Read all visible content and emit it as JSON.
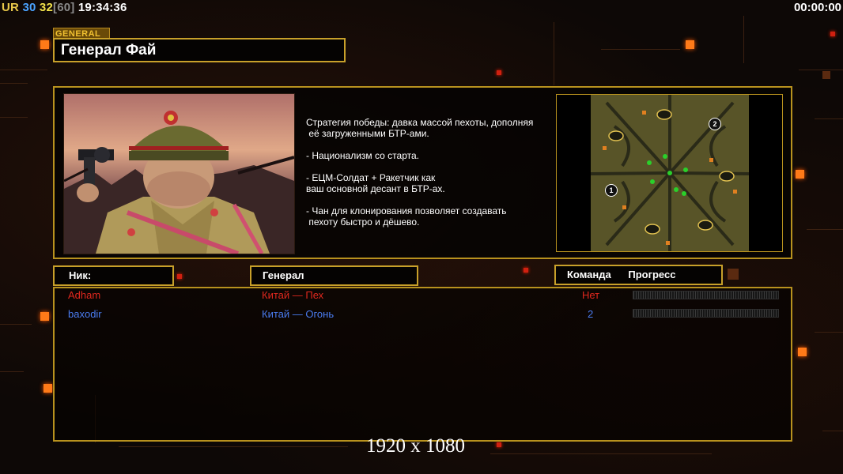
{
  "hud": {
    "ur": "UR",
    "val30": "30",
    "val32": "32",
    "val60": "[60]",
    "clock": "19:34:36",
    "timer": "00:00:00"
  },
  "general": {
    "tag": "GENERAL",
    "name": "Генерал Фай",
    "description": [
      "Стратегия победы: давка массой пехоты, дополняя",
      " её загруженными БТР-ами.",
      "",
      "- Национализм со старта.",
      "",
      "- ЕЦМ-Солдат + Ракетчик как",
      "ваш основной десант в БТР-ах.",
      "",
      "- Чан для клонирования позволяет создавать",
      " пехоту быстро и дёшево."
    ]
  },
  "map": {
    "start_markers": [
      "1",
      "2"
    ]
  },
  "table": {
    "headers": {
      "nick": "Ник:",
      "general": "Генерал",
      "team": "Команда",
      "progress": "Прогресс"
    },
    "rows": [
      {
        "nick": "Adham",
        "general": "Китай — Пех",
        "team": "Нет",
        "progress": 0,
        "color": "#e0281e"
      },
      {
        "nick": "baxodir",
        "general": "Китай — Огонь",
        "team": "2",
        "progress": 0,
        "color": "#4a7cf0"
      }
    ]
  },
  "watermark": "1920 x 1080",
  "colors": {
    "frame": "#c8a02a",
    "accent": "#ff7a18"
  }
}
